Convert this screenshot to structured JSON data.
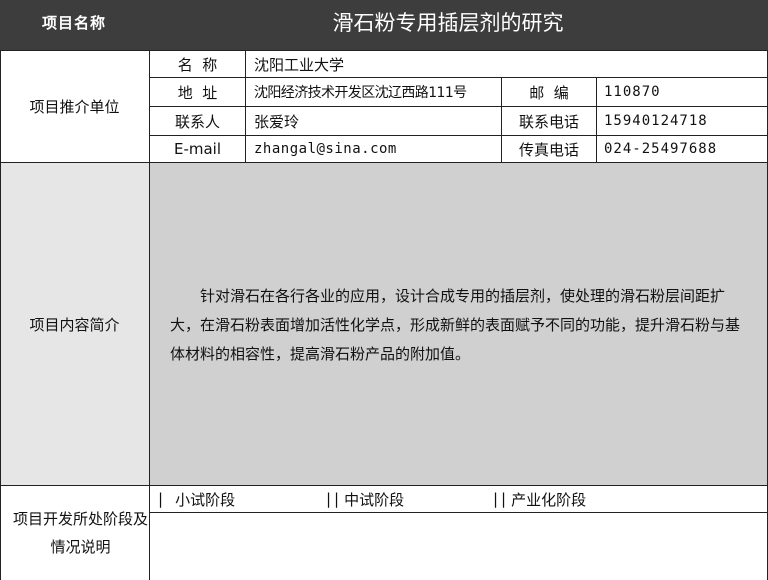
{
  "header": {
    "label": "项目名称",
    "title": "滑石粉专用插层剂的研究"
  },
  "unit_section": {
    "label": "项目推介单位",
    "name_label": "名  称",
    "name_value": "沈阳工业大学",
    "address_label": "地  址",
    "address_value": "沈阳经济技术开发区沈辽西路111号",
    "postcode_label": "邮  编",
    "postcode_value": "110870",
    "contact_label": "联系人",
    "contact_value": "张爱玲",
    "phone_label": "联系电话",
    "phone_value": "15940124718",
    "email_label": "E-mail",
    "email_value": "zhangal@sina.com",
    "fax_label": "传真电话",
    "fax_value": "024-25497688"
  },
  "content_section": {
    "label": "项目内容简介",
    "text": "针对滑石在各行各业的应用，设计合成专用的插层剂，使处理的滑石粉层间距扩大，在滑石粉表面增加活性化学点，形成新鲜的表面赋予不同的功能，提升滑石粉与基体材料的相容性，提高滑石粉产品的附加值。"
  },
  "stage_section": {
    "label": "项目开发所处阶段及情况说明",
    "options": [
      {
        "mark": "|",
        "label": "小试阶段"
      },
      {
        "mark": "||",
        "label": "中试阶段"
      },
      {
        "mark": "||",
        "label": "产业化阶段"
      }
    ]
  }
}
